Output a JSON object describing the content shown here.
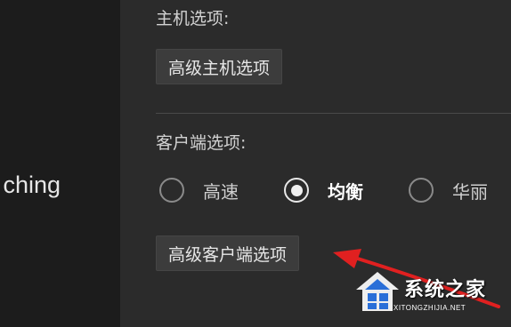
{
  "sidebar": {
    "partial_item_label": "ching"
  },
  "host_options": {
    "title": "主机选项:",
    "advanced_button": "高级主机选项"
  },
  "client_options": {
    "title": "客户端选项:",
    "radios": [
      {
        "label": "高速",
        "selected": false
      },
      {
        "label": "均衡",
        "selected": true
      },
      {
        "label": "华丽",
        "selected": false
      }
    ],
    "advanced_button": "高级客户端选项"
  },
  "annotation": {
    "arrow_color": "#e02020"
  },
  "watermark": {
    "title": "系统之家",
    "url": "XITONGZHIJIA.NET"
  }
}
